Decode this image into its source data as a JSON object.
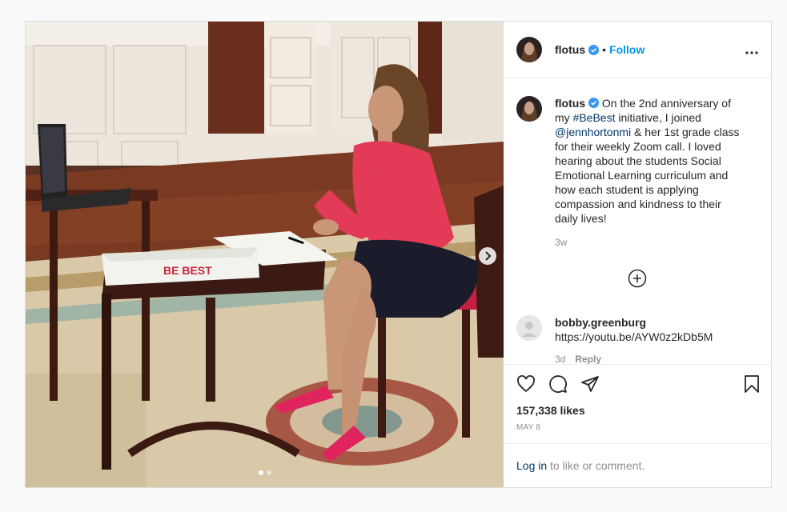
{
  "post": {
    "username": "flotus",
    "separator": "•",
    "follow_label": "Follow",
    "more_label": "•••",
    "caption": {
      "username": "flotus",
      "text_1": "On the 2nd anniversary of my ",
      "hashtag": "#BeBest",
      "text_2": " initiative, I joined ",
      "mention": "@jennhortonmi",
      "text_3": " & her 1st grade class for their weekly Zoom call. I loved hearing about the students Social Emotional Learning curriculum and how each student is applying compassion and kindness to their daily lives!",
      "time": "3w"
    },
    "comment": {
      "username": "bobby.greenburg",
      "text": "https://youtu.be/AYW0z2kDb5M",
      "time": "3d",
      "reply_label": "Reply"
    },
    "likes": "157,338 likes",
    "date": "MAY 8",
    "login_link": "Log in",
    "login_text": " to like or comment.",
    "media_bag_text": "BE BEST",
    "colors": {
      "accent": "#0095f6",
      "link": "#00376b",
      "muted": "#8e8e8e",
      "blouse": "#e23a57"
    },
    "icons": [
      "verified-badge-icon",
      "more-options-icon",
      "load-more-comments-icon",
      "heart-icon",
      "comment-icon",
      "share-icon",
      "bookmark-icon",
      "chevron-right-icon",
      "default-avatar-icon"
    ]
  }
}
